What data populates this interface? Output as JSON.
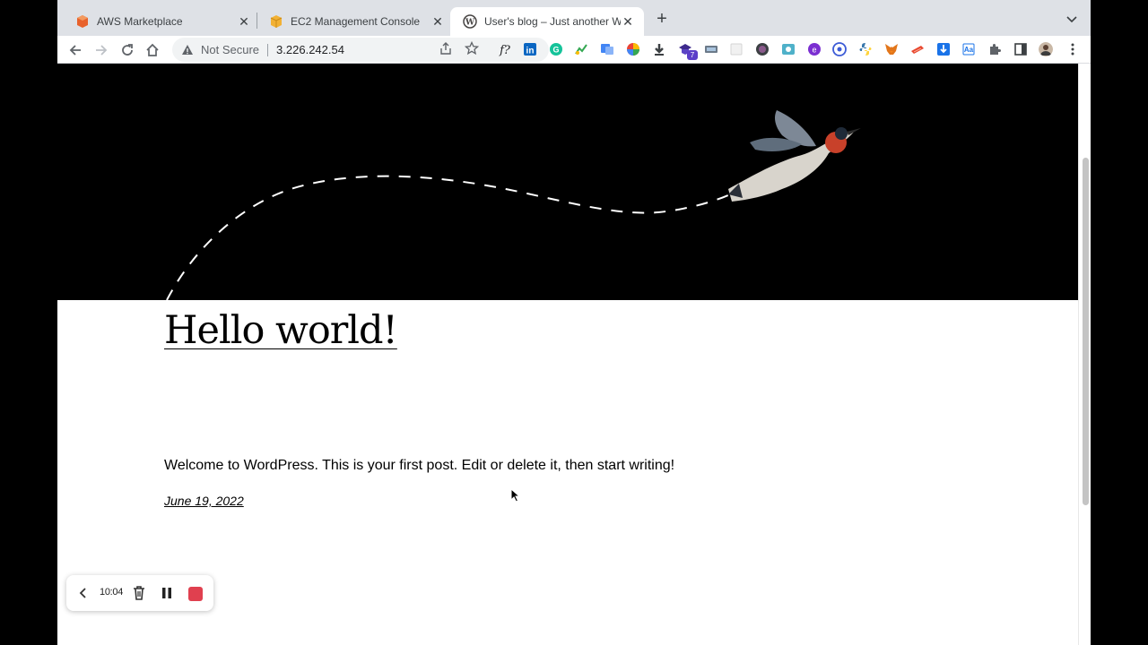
{
  "browser": {
    "tabs": [
      {
        "title": "AWS Marketplace",
        "favicon": "aws-marketplace-icon",
        "active": false
      },
      {
        "title": "EC2 Management Console",
        "favicon": "ec2-cube-icon",
        "active": false
      },
      {
        "title": "User's blog – Just another Wo",
        "favicon": "wordpress-icon",
        "active": true
      }
    ],
    "omnibox": {
      "security_label": "Not Secure",
      "url": "3.226.242.54"
    },
    "extensions_badge": "7"
  },
  "post": {
    "title": "Hello world!",
    "excerpt": "Welcome to WordPress. This is your first post. Edit or delete it, then start writing!",
    "date": "June 19, 2022"
  },
  "recorder": {
    "elapsed": "10:04",
    "stop_color": "#e0404f"
  },
  "colors": {
    "hero_background": "#000000",
    "tabstrip": "#dee1e6"
  }
}
